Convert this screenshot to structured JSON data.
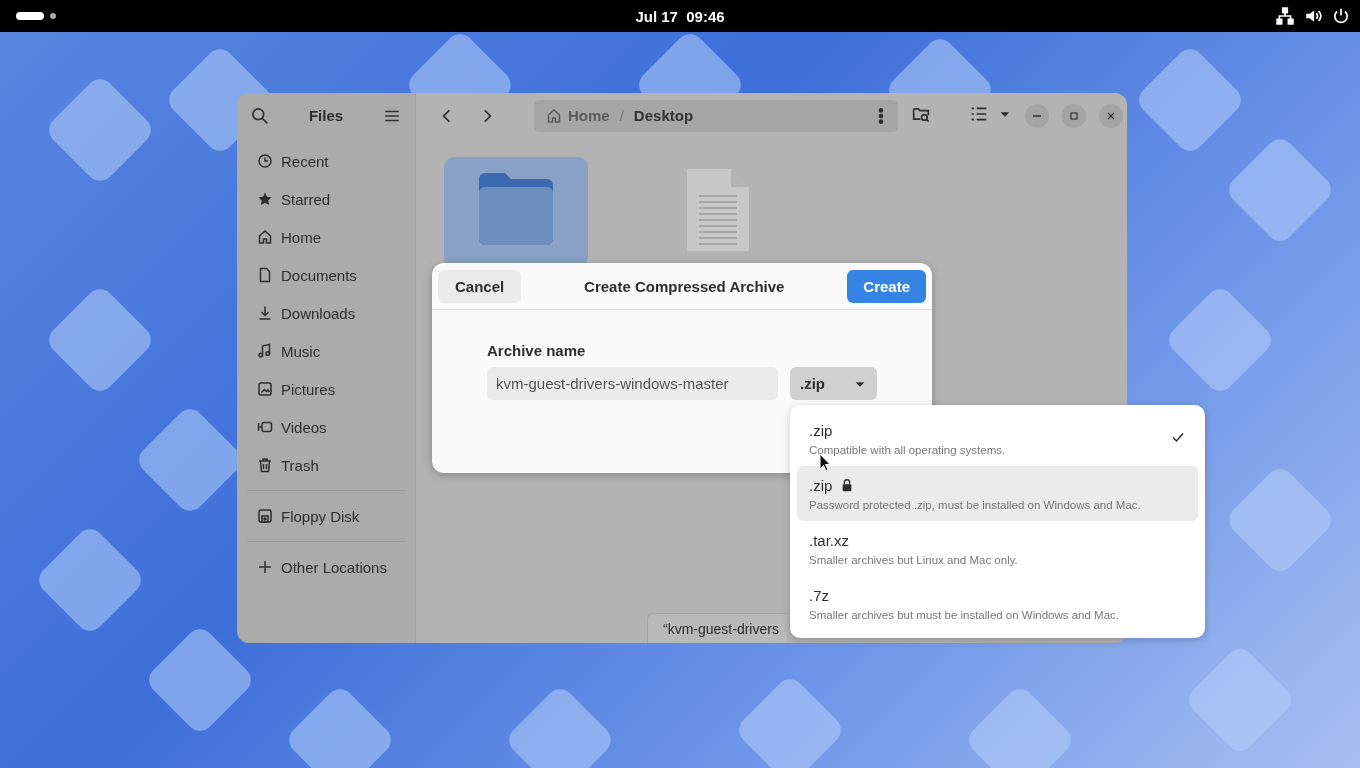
{
  "top_bar": {
    "clock": "Jul 17  09:46"
  },
  "files_window": {
    "sidebar": {
      "title": "Files",
      "sections": [
        [
          {
            "label": "Recent"
          },
          {
            "label": "Starred"
          },
          {
            "label": "Home"
          },
          {
            "label": "Documents"
          },
          {
            "label": "Downloads"
          },
          {
            "label": "Music"
          },
          {
            "label": "Pictures"
          },
          {
            "label": "Videos"
          },
          {
            "label": "Trash"
          }
        ],
        [
          {
            "label": "Floppy Disk"
          }
        ],
        [
          {
            "label": "Other Locations"
          }
        ]
      ]
    },
    "path": {
      "crumbs": [
        "Home",
        "Desktop"
      ],
      "separator": "/"
    },
    "files": [
      {
        "kind": "folder",
        "selected": true
      },
      {
        "kind": "document",
        "selected": false
      }
    ],
    "status": "“kvm-guest-drivers"
  },
  "dialog": {
    "cancel": "Cancel",
    "title": "Create Compressed Archive",
    "create": "Create",
    "field_label": "Archive name",
    "value": "kvm-guest-drivers-windows-master",
    "format": ".zip"
  },
  "format_menu": [
    {
      "label": ".zip",
      "description": "Compatible with all operating systems.",
      "locked": false,
      "checked": true,
      "selected": false
    },
    {
      "label": ".zip",
      "description": "Password protected .zip, must be installed on Windows and Mac.",
      "locked": true,
      "checked": false,
      "selected": true
    },
    {
      "label": ".tar.xz",
      "description": "Smaller archives but Linux and Mac only.",
      "locked": false,
      "checked": false,
      "selected": false
    },
    {
      "label": ".7z",
      "description": "Smaller archives but must be installed on Windows and Mac.",
      "locked": false,
      "checked": false,
      "selected": false
    }
  ]
}
